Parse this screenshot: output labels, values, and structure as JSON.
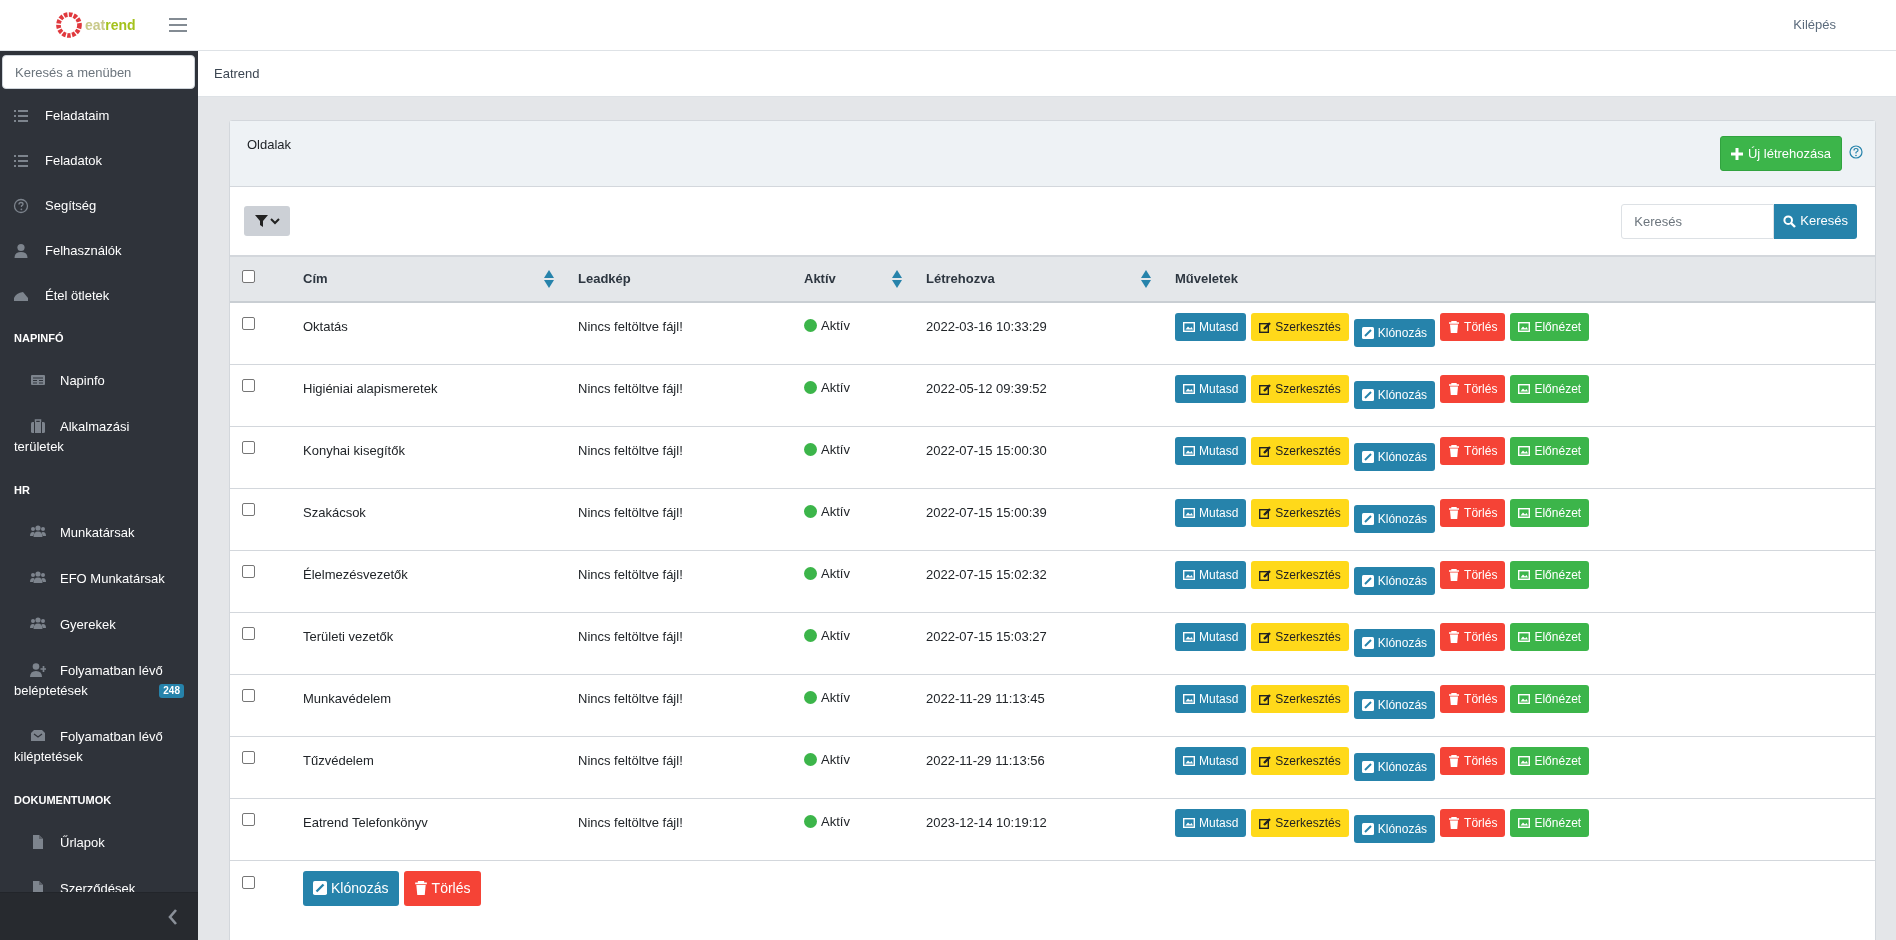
{
  "logo": {
    "text_1": "eat",
    "text_2": "rend"
  },
  "top_bar": {
    "logout": "Kilépés"
  },
  "sidebar": {
    "search_placeholder": "Keresés a menüben",
    "items": [
      {
        "label": "Feladataim"
      },
      {
        "label": "Feladatok"
      },
      {
        "label": "Segítség"
      },
      {
        "label": "Felhasználók"
      },
      {
        "label": "Étel ötletek"
      }
    ],
    "sections": [
      {
        "title": "NAPINFÓ",
        "items": [
          {
            "label": "Napinfo"
          },
          {
            "label": "Alkalmazási területek"
          }
        ]
      },
      {
        "title": "HR",
        "items": [
          {
            "label": "Munkatársak"
          },
          {
            "label": "EFO Munkatársak"
          },
          {
            "label": "Gyerekek"
          },
          {
            "label": "Folyamatban lévő beléptetések",
            "badge": "248"
          },
          {
            "label": "Folyamatban lévő kiléptetések"
          }
        ]
      },
      {
        "title": "DOKUMENTUMOK",
        "items": [
          {
            "label": "Űrlapok"
          },
          {
            "label": "Szerződések"
          }
        ]
      }
    ]
  },
  "breadcrumb": "Eatrend",
  "card": {
    "title": "Oldalak",
    "create_button": "Új létrehozása",
    "search": {
      "placeholder": "Keresés",
      "button": "Keresés"
    }
  },
  "table": {
    "select_all": {
      "checked": false
    },
    "columns": [
      {
        "label": "Cím",
        "sortable": true
      },
      {
        "label": "Leadkép",
        "sortable": false
      },
      {
        "label": "Aktív",
        "sortable": true
      },
      {
        "label": "Létrehozva",
        "sortable": true
      },
      {
        "label": "Műveletek",
        "sortable": false
      }
    ],
    "rows": [
      {
        "checked": false,
        "title": "Oktatás",
        "lead_image": "Nincs feltöltve fájl!",
        "status": {
          "label": "Aktív",
          "color": "#3cb54a"
        },
        "created": "2022-03-16 10:33:29",
        "actions": [
          {
            "kind": "show",
            "label": "Mutasd"
          },
          {
            "kind": "edit",
            "label": "Szerkesztés"
          },
          {
            "kind": "clone",
            "label": "Klónozás"
          },
          {
            "kind": "delete",
            "label": "Törlés"
          },
          {
            "kind": "preview",
            "label": "Előnézet"
          }
        ]
      },
      {
        "checked": false,
        "title": "Higiéniai alapismeretek",
        "lead_image": "Nincs feltöltve fájl!",
        "status": {
          "label": "Aktív",
          "color": "#3cb54a"
        },
        "created": "2022-05-12 09:39:52",
        "actions": [
          {
            "kind": "show",
            "label": "Mutasd"
          },
          {
            "kind": "edit",
            "label": "Szerkesztés"
          },
          {
            "kind": "clone",
            "label": "Klónozás"
          },
          {
            "kind": "delete",
            "label": "Törlés"
          },
          {
            "kind": "preview",
            "label": "Előnézet"
          }
        ]
      },
      {
        "checked": false,
        "title": "Konyhai kisegítők",
        "lead_image": "Nincs feltöltve fájl!",
        "status": {
          "label": "Aktív",
          "color": "#3cb54a"
        },
        "created": "2022-07-15 15:00:30",
        "actions": [
          {
            "kind": "show",
            "label": "Mutasd"
          },
          {
            "kind": "edit",
            "label": "Szerkesztés"
          },
          {
            "kind": "clone",
            "label": "Klónozás"
          },
          {
            "kind": "delete",
            "label": "Törlés"
          },
          {
            "kind": "preview",
            "label": "Előnézet"
          }
        ]
      },
      {
        "checked": false,
        "title": "Szakácsok",
        "lead_image": "Nincs feltöltve fájl!",
        "status": {
          "label": "Aktív",
          "color": "#3cb54a"
        },
        "created": "2022-07-15 15:00:39",
        "actions": [
          {
            "kind": "show",
            "label": "Mutasd"
          },
          {
            "kind": "edit",
            "label": "Szerkesztés"
          },
          {
            "kind": "clone",
            "label": "Klónozás"
          },
          {
            "kind": "delete",
            "label": "Törlés"
          },
          {
            "kind": "preview",
            "label": "Előnézet"
          }
        ]
      },
      {
        "checked": false,
        "title": "Élelmezésvezetők",
        "lead_image": "Nincs feltöltve fájl!",
        "status": {
          "label": "Aktív",
          "color": "#3cb54a"
        },
        "created": "2022-07-15 15:02:32",
        "actions": [
          {
            "kind": "show",
            "label": "Mutasd"
          },
          {
            "kind": "edit",
            "label": "Szerkesztés"
          },
          {
            "kind": "clone",
            "label": "Klónozás"
          },
          {
            "kind": "delete",
            "label": "Törlés"
          },
          {
            "kind": "preview",
            "label": "Előnézet"
          }
        ]
      },
      {
        "checked": false,
        "title": "Területi vezetők",
        "lead_image": "Nincs feltöltve fájl!",
        "status": {
          "label": "Aktív",
          "color": "#3cb54a"
        },
        "created": "2022-07-15 15:03:27",
        "actions": [
          {
            "kind": "show",
            "label": "Mutasd"
          },
          {
            "kind": "edit",
            "label": "Szerkesztés"
          },
          {
            "kind": "clone",
            "label": "Klónozás"
          },
          {
            "kind": "delete",
            "label": "Törlés"
          },
          {
            "kind": "preview",
            "label": "Előnézet"
          }
        ]
      },
      {
        "checked": false,
        "title": "Munkavédelem",
        "lead_image": "Nincs feltöltve fájl!",
        "status": {
          "label": "Aktív",
          "color": "#3cb54a"
        },
        "created": "2022-11-29 11:13:45",
        "actions": [
          {
            "kind": "show",
            "label": "Mutasd"
          },
          {
            "kind": "edit",
            "label": "Szerkesztés"
          },
          {
            "kind": "clone",
            "label": "Klónozás"
          },
          {
            "kind": "delete",
            "label": "Törlés"
          },
          {
            "kind": "preview",
            "label": "Előnézet"
          }
        ]
      },
      {
        "checked": false,
        "title": "Tűzvédelem",
        "lead_image": "Nincs feltöltve fájl!",
        "status": {
          "label": "Aktív",
          "color": "#3cb54a"
        },
        "created": "2022-11-29 11:13:56",
        "actions": [
          {
            "kind": "show",
            "label": "Mutasd"
          },
          {
            "kind": "edit",
            "label": "Szerkesztés"
          },
          {
            "kind": "clone",
            "label": "Klónozás"
          },
          {
            "kind": "delete",
            "label": "Törlés"
          },
          {
            "kind": "preview",
            "label": "Előnézet"
          }
        ]
      },
      {
        "checked": false,
        "title": "Eatrend Telefonkönyv",
        "lead_image": "Nincs feltöltve fájl!",
        "status": {
          "label": "Aktív",
          "color": "#3cb54a"
        },
        "created": "2023-12-14 10:19:12",
        "actions": [
          {
            "kind": "show",
            "label": "Mutasd"
          },
          {
            "kind": "edit",
            "label": "Szerkesztés"
          },
          {
            "kind": "clone",
            "label": "Klónozás"
          },
          {
            "kind": "delete",
            "label": "Törlés"
          },
          {
            "kind": "preview",
            "label": "Előnézet"
          }
        ]
      }
    ],
    "bulk": {
      "checked": false,
      "actions": [
        {
          "kind": "clone",
          "label": "Klónozás"
        },
        {
          "kind": "delete",
          "label": "Törlés"
        }
      ]
    }
  }
}
